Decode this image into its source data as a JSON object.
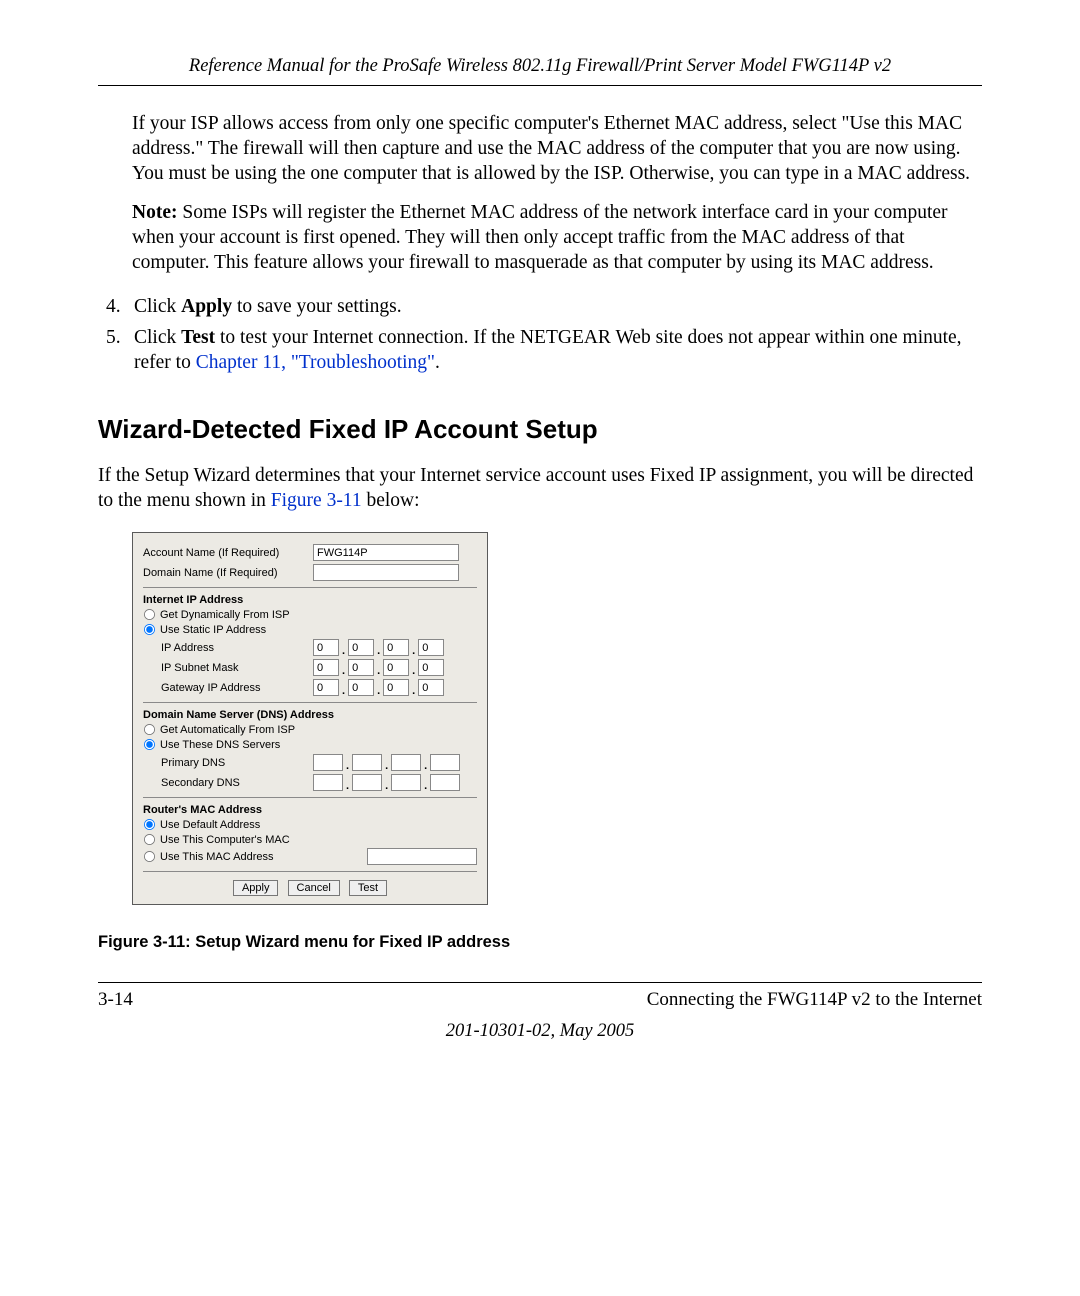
{
  "header": {
    "title": "Reference Manual for the ProSafe Wireless 802.11g  Firewall/Print Server Model FWG114P v2"
  },
  "paragraphs": {
    "p1": "If your ISP allows access from only one specific computer's Ethernet MAC address, select \"Use this MAC address.\" The firewall will then capture and use the MAC address of the computer that you are now using. You must be using the one computer that is allowed by the ISP. Otherwise, you can type in a MAC address.",
    "note_label": "Note:",
    "note_body": "  Some ISPs will register the Ethernet MAC address of the network interface card in your computer when your account is first opened. They will then only accept traffic from the MAC address of that computer. This feature allows your firewall to masquerade as that computer by using its MAC address."
  },
  "steps": {
    "s4_num": "4.",
    "s4_a": "Click ",
    "s4_bold": "Apply",
    "s4_b": " to save your settings.",
    "s5_num": "5.",
    "s5_a": "Click ",
    "s5_bold": "Test",
    "s5_b": " to test your Internet connection. If the NETGEAR Web site does not appear within one minute, refer to ",
    "s5_link": "Chapter 11, \"Troubleshooting\"",
    "s5_c": "."
  },
  "heading": "Wizard-Detected Fixed IP Account Setup",
  "after_heading_a": "If the Setup Wizard determines that your Internet service account uses Fixed IP assignment, you will be directed to the menu shown in ",
  "after_heading_link": "Figure 3-11",
  "after_heading_b": " below:",
  "panel": {
    "acct_label": "Account Name  (If Required)",
    "acct_value": "FWG114P",
    "domain_label": "Domain Name  (If Required)",
    "sect_ip": "Internet IP Address",
    "radio_dyn": "Get Dynamically From ISP",
    "radio_static": "Use Static IP Address",
    "ip_addr": "IP Address",
    "ip_mask": "IP Subnet Mask",
    "ip_gw": "Gateway IP Address",
    "oct0": "0",
    "sect_dns": "Domain Name Server (DNS) Address",
    "radio_dns_auto": "Get Automatically From ISP",
    "radio_dns_use": "Use These DNS Servers",
    "dns_primary": "Primary DNS",
    "dns_secondary": "Secondary DNS",
    "sect_mac": "Router's MAC Address",
    "radio_mac_default": "Use Default Address",
    "radio_mac_comp": "Use This Computer's MAC",
    "radio_mac_this": "Use This MAC Address",
    "btn_apply": "Apply",
    "btn_cancel": "Cancel",
    "btn_test": "Test"
  },
  "figcaption": "Figure 3-11: Setup Wizard menu for Fixed IP address",
  "footer": {
    "left": "3-14",
    "right": "Connecting the FWG114P v2 to the Internet",
    "center": "201-10301-02, May 2005"
  }
}
